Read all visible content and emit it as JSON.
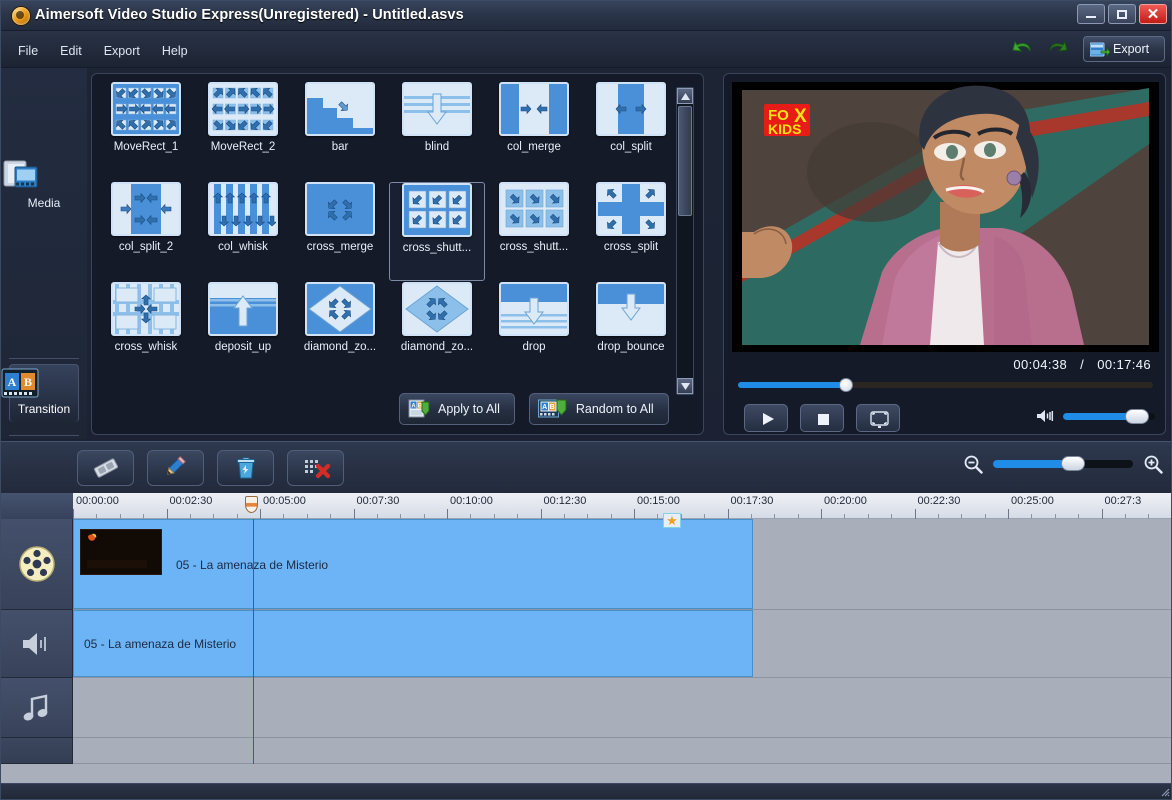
{
  "window": {
    "title": "Aimersoft Video Studio Express(Unregistered) - Untitled.asvs",
    "logo_icon": "aimersoft-logo-icon",
    "minimize_label": "Minimize",
    "maximize_label": "Maximize",
    "close_label": "Close"
  },
  "menu": {
    "items": [
      {
        "label": "File"
      },
      {
        "label": "Edit"
      },
      {
        "label": "Export"
      },
      {
        "label": "Help"
      }
    ],
    "undo_icon": "undo-arrow-icon",
    "redo_icon": "redo-arrow-icon",
    "export_label": "Export",
    "export_icon": "export-film-icon"
  },
  "rail": {
    "items": [
      {
        "label": "Media",
        "icon": "media-folder-icon",
        "active": false
      },
      {
        "label": "Transition",
        "icon": "transition-ab-icon",
        "active": true
      }
    ]
  },
  "transitions": {
    "selected_index": 9,
    "items": [
      {
        "label": "MoveRect_1",
        "thumb": "grid-arrows-in"
      },
      {
        "label": "MoveRect_2",
        "thumb": "grid-arrows-out"
      },
      {
        "label": "bar",
        "thumb": "stair-step"
      },
      {
        "label": "blind",
        "thumb": "blind-down-arrow"
      },
      {
        "label": "col_merge",
        "thumb": "col-merge-arrows"
      },
      {
        "label": "col_split",
        "thumb": "col-split-arrows"
      },
      {
        "label": "col_split_2",
        "thumb": "col-split2-arrows"
      },
      {
        "label": "col_whisk",
        "thumb": "col-whisk-arrows"
      },
      {
        "label": "cross_merge",
        "thumb": "cross-merge-arrows"
      },
      {
        "label": "cross_shutt...",
        "thumb": "cross-shutter-a"
      },
      {
        "label": "cross_shutt...",
        "thumb": "cross-shutter-b"
      },
      {
        "label": "cross_split",
        "thumb": "cross-split-arrows"
      },
      {
        "label": "cross_whisk",
        "thumb": "cross-whisk"
      },
      {
        "label": "deposit_up",
        "thumb": "deposit-up-arrow"
      },
      {
        "label": "diamond_zo...",
        "thumb": "diamond-zoom-in"
      },
      {
        "label": "diamond_zo...",
        "thumb": "diamond-zoom-out"
      },
      {
        "label": "drop",
        "thumb": "drop-arrow"
      },
      {
        "label": "drop_bounce",
        "thumb": "drop-bounce-arrow"
      }
    ],
    "apply_to_all_label": "Apply to All",
    "apply_to_all_icon": "apply-ab-icon",
    "random_to_all_label": "Random to All",
    "random_to_all_icon": "random-ab-icon",
    "scroll_up_icon": "scroll-up-arrow-icon",
    "scroll_down_icon": "scroll-down-arrow-icon"
  },
  "preview": {
    "current_time": "00:04:38",
    "separator": "/",
    "total_time": "00:17:46",
    "progress_percent": 26,
    "volume_percent": 78,
    "play_icon": "play-icon",
    "stop_icon": "stop-icon",
    "fullscreen_icon": "fullscreen-icon",
    "volume_icon": "speaker-icon",
    "overlay_text_line1": "FOX",
    "overlay_text_line2": "KIDS"
  },
  "editor_toolbar": {
    "buttons": [
      {
        "name": "split-button",
        "icon": "razor-blade-icon"
      },
      {
        "name": "edit-button",
        "icon": "pencil-icon"
      },
      {
        "name": "delete-button",
        "icon": "trash-can-icon"
      },
      {
        "name": "delete-all-button",
        "icon": "clear-all-x-icon"
      }
    ],
    "zoom_out_icon": "zoom-out-icon",
    "zoom_in_icon": "zoom-in-icon",
    "zoom_percent": 50
  },
  "timeline": {
    "ruler_labels": [
      "00:00:00",
      "00:02:30",
      "00:05:00",
      "00:07:30",
      "00:10:00",
      "00:12:30",
      "00:15:00",
      "00:17:30",
      "00:20:00",
      "00:22:30",
      "00:25:00",
      "00:27:3"
    ],
    "playhead_time": "00:03:40",
    "tracks": [
      {
        "name": "video-track",
        "icon": "film-reel-icon",
        "clip_label": "05 - La amenaza de Misterio",
        "has_thumbnail": true,
        "has_effect_marker": true,
        "effect_marker_icon": "star-icon"
      },
      {
        "name": "audio-track",
        "icon": "speaker-icon",
        "clip_label": "05 - La amenaza de Misterio",
        "has_thumbnail": false,
        "has_effect_marker": false
      },
      {
        "name": "music-track",
        "icon": "music-note-icon",
        "clip_label": "",
        "has_thumbnail": false,
        "has_effect_marker": false
      }
    ]
  },
  "colors": {
    "accent": "#1f8ce8",
    "clip": "#6cb4f5",
    "playhead": "#e02020",
    "panel_bg": "#141a28",
    "chrome": "#222a3b"
  }
}
